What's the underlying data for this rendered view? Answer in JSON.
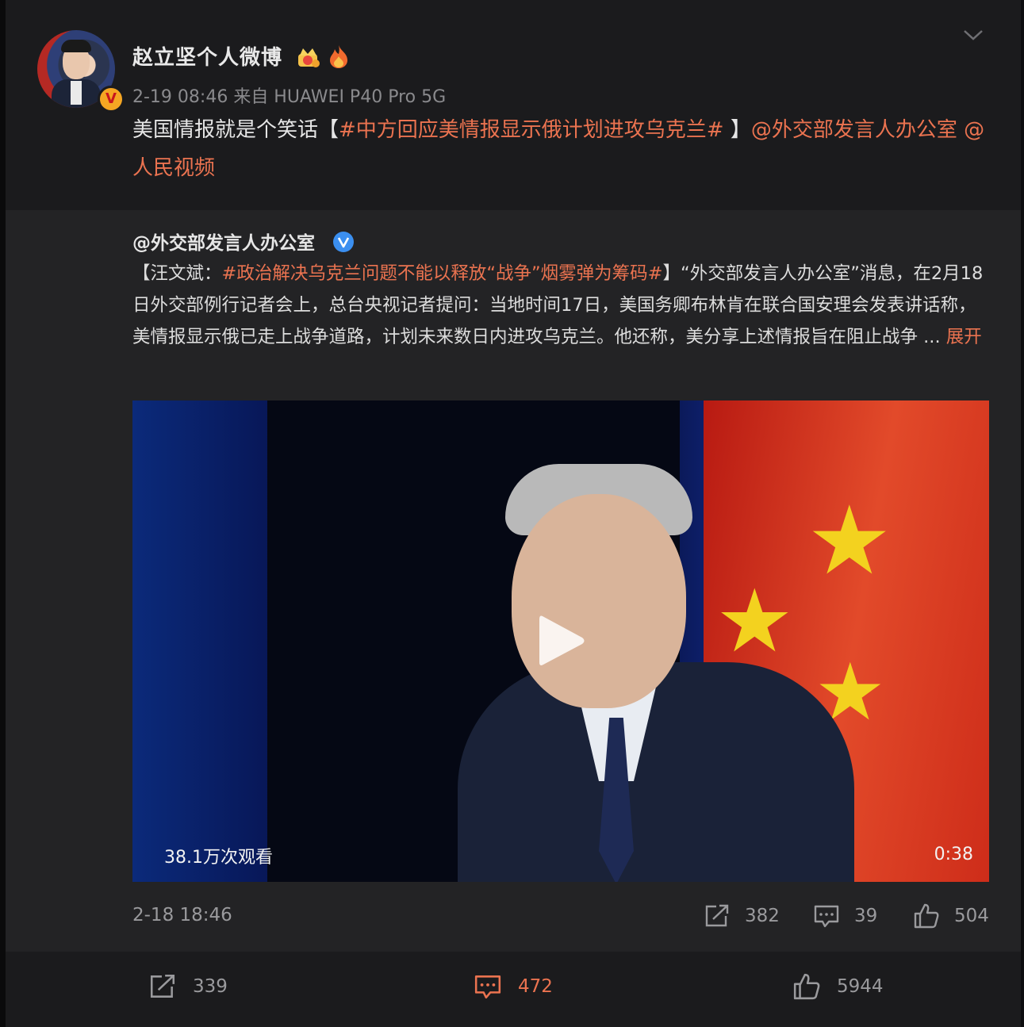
{
  "post": {
    "username": "赵立坚个人微博",
    "meta": "2-19 08:46  来自 HUAWEI P40 Pro 5G",
    "text_plain": "美国情报就是个笑话【",
    "hashtag": "#中方回应美情报显示俄计划进攻乌克兰#",
    "text_bracket_close": " 】",
    "mention1": "@外交部发言人办公室",
    "mention2": "@人民视频",
    "badge": "V"
  },
  "repost": {
    "author": "@外交部发言人办公室",
    "text_prefix": "【汪文斌：",
    "hashtag": "#政治解决乌克兰问题不能以释放“战争”烟雾弹为筹码#",
    "text_body": "】“外交部发言人办公室”消息，在2月18日外交部例行记者会上，总台央视记者提问：当地时间17日，美国务卿布林肯在联合国安理会发表讲话称，美情报显示俄已走上战争道路，计划未来数日内进攻乌克兰。他还称，美分享上述情报旨在阻止战争  ... ",
    "expand": "展开",
    "video": {
      "views": "38.1万次观看",
      "duration": "0:38"
    },
    "time": "2-18 18:46",
    "share_count": "382",
    "comment_count": "39",
    "like_count": "504"
  },
  "footer": {
    "share_count": "339",
    "comment_count": "472",
    "like_count": "5944"
  },
  "colors": {
    "accent": "#eb7350",
    "verified_blue": "#3b8ff0",
    "verified_gold": "#f5a623"
  }
}
